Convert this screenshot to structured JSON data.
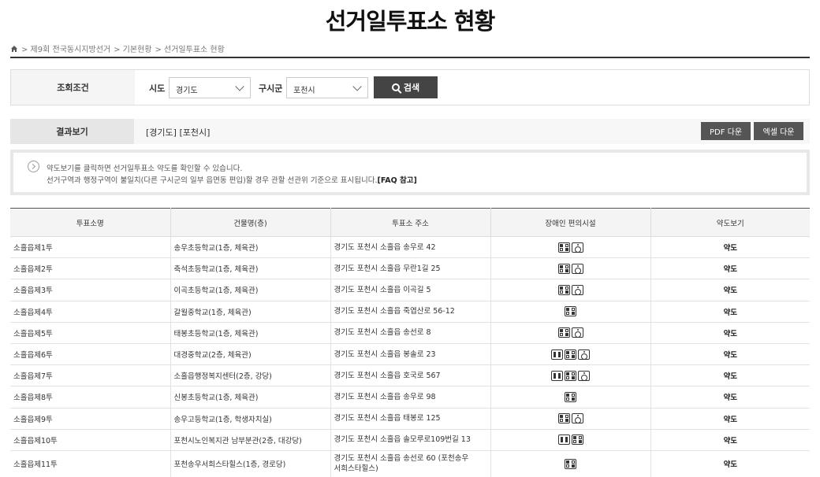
{
  "page": {
    "title": "선거일투표소 현황"
  },
  "breadcrumb": {
    "home_icon": "home-icon",
    "items": [
      "> 제9회 전국동시지방선거",
      "> 기본현황",
      "> 선거일투표소 현황"
    ]
  },
  "search": {
    "label": "조회조건",
    "sido_label": "시도",
    "sido_value": "경기도",
    "sigungu_label": "구시군",
    "sigungu_value": "포천시",
    "button_label": "검색"
  },
  "result": {
    "label": "결과보기",
    "text": "[경기도] [포천시]",
    "pdf_button": "PDF 다운",
    "excel_button": "엑셀 다운"
  },
  "notice": {
    "line1": "약도보기를 클릭하면 선거일투표소 약도를 확인할 수 있습니다.",
    "line2": "선거구역과 행정구역이 불일치(다른 구시군의 일부 읍면동 편입)할 경우 관할 선관위 기준으로 표시됩니다.",
    "faq_link": "[FAQ 참고]"
  },
  "table": {
    "headers": [
      "투표소명",
      "건물명(층)",
      "투표소 주소",
      "장애인 편의시설",
      "약도보기"
    ],
    "rows": [
      {
        "name": "소흘읍제1투",
        "building": "송우초등학교(1층, 체육관)",
        "address": "경기도 포천시 소흘읍 송우로 42",
        "address2": "",
        "facilities": [
          "ramp-icon",
          "wheelchair-icon"
        ],
        "map": "약도"
      },
      {
        "name": "소흘읍제2투",
        "building": "축석초등학교(1층, 체육관)",
        "address": "경기도 포천시 소흘읍 무란1길 25",
        "address2": "",
        "facilities": [
          "ramp-icon",
          "wheelchair-icon"
        ],
        "map": "약도"
      },
      {
        "name": "소흘읍제3투",
        "building": "이곡초등학교(1층, 체육관)",
        "address": "경기도 포천시 소흘읍 이곡길 5",
        "address2": "",
        "facilities": [
          "ramp-icon",
          "wheelchair-icon"
        ],
        "map": "약도"
      },
      {
        "name": "소흘읍제4투",
        "building": "갈월중학교(1층, 체육관)",
        "address": "경기도 포천시 소흘읍 죽엽산로 56-12",
        "address2": "",
        "facilities": [
          "ramp-icon"
        ],
        "map": "약도"
      },
      {
        "name": "소흘읍제5투",
        "building": "태봉초등학교(1층, 체육관)",
        "address": "경기도 포천시 소흘읍 송선로 8",
        "address2": "",
        "facilities": [
          "ramp-icon",
          "wheelchair-icon"
        ],
        "map": "약도"
      },
      {
        "name": "소흘읍제6투",
        "building": "대경중학교(2층, 체육관)",
        "address": "경기도 포천시 소흘읍 봉솔로 23",
        "address2": "",
        "facilities": [
          "toilet-icon",
          "ramp-icon",
          "wheelchair-icon"
        ],
        "map": "약도"
      },
      {
        "name": "소흘읍제7투",
        "building": "소흘읍행정복지센터(2층, 강당)",
        "address": "경기도 포천시 소흘읍 호국로 567",
        "address2": "",
        "facilities": [
          "toilet-icon",
          "ramp-icon",
          "wheelchair-icon"
        ],
        "map": "약도"
      },
      {
        "name": "소흘읍제8투",
        "building": "신봉초등학교(1층, 체육관)",
        "address": "경기도 포천시 소흘읍 송우로 98",
        "address2": "",
        "facilities": [
          "ramp-icon"
        ],
        "map": "약도"
      },
      {
        "name": "소흘읍제9투",
        "building": "송우고등학교(1층, 학생자치실)",
        "address": "경기도 포천시 소흘읍 태봉로 125",
        "address2": "",
        "facilities": [
          "ramp-icon",
          "wheelchair-icon"
        ],
        "map": "약도"
      },
      {
        "name": "소흘읍제10투",
        "building": "포천시노인복지관 남부분관(2층, 대강당)",
        "address": "경기도 포천시 소흘읍 솔모루로109번길 13",
        "address2": "",
        "facilities": [
          "toilet-icon",
          "ramp-icon"
        ],
        "map": "약도"
      },
      {
        "name": "소흘읍제11투",
        "building": "포천송우서희스타힐스(1층, 경로당)",
        "address": "경기도 포천시 소흘읍 송선로 60 (포천송우",
        "address2": "서희스타힐스)",
        "facilities": [
          "ramp-icon"
        ],
        "map": "약도"
      }
    ]
  }
}
